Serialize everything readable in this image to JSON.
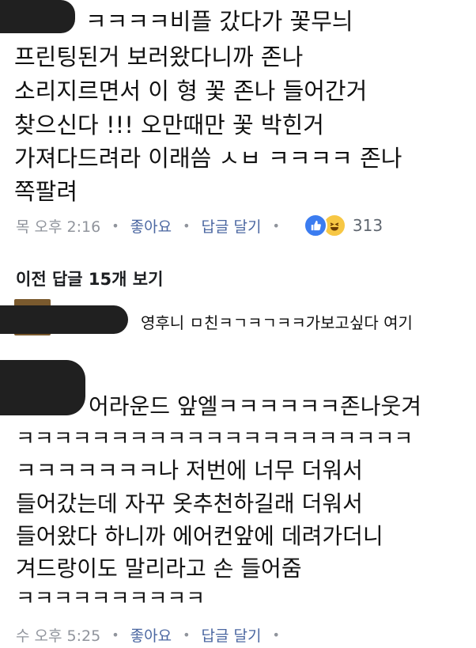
{
  "comment1": {
    "lines": [
      "ㅋㅋㅋㅋ비플 갔다가 꽃무늬",
      "프린팅된거 보러왔다니까 존나",
      "소리지르면서 이 형 꽃 존나 들어간거",
      "찾으신다 !!! 오만때만 꽃 박힌거",
      "가져다드려라 이래씀 ㅅㅂ ㅋㅋㅋㅋ 존나",
      "쪽팔려"
    ],
    "time": "목 오후 2:16",
    "like": "좋아요",
    "reply": "답글 달기",
    "reaction_count": "313"
  },
  "prev_replies": "이전 답글 15개 보기",
  "reply1": {
    "text": "영후니 ㅁ친ㅋㄱㅋㄱㅋㅋ가보고싶다 여기"
  },
  "comment2": {
    "lines": [
      "어라운드 앞엘ㅋㅋㅋㅋㅋㅋ존나웃겨",
      "ㅋㅋㅋㅋㅋㅋㅋㅋㅋㅋㅋㅋㅋㅋㅋㅋㅋㅋㅋㅋㅋ",
      "ㅋㅋㅋㅋㅋㅋㅋ나 저번에 너무 더워서",
      "들어갔는데 자꾸 옷추천하길래 더워서",
      "들어왔다 하니까 에어컨앞에 데려가더니",
      "겨드랑이도 말리라고 손 들어줌",
      "ㅋㅋㅋㅋㅋㅋㅋㅋㅋㅋ"
    ],
    "time": "수 오후 5:25",
    "like": "좋아요",
    "reply": "답글 달기"
  }
}
